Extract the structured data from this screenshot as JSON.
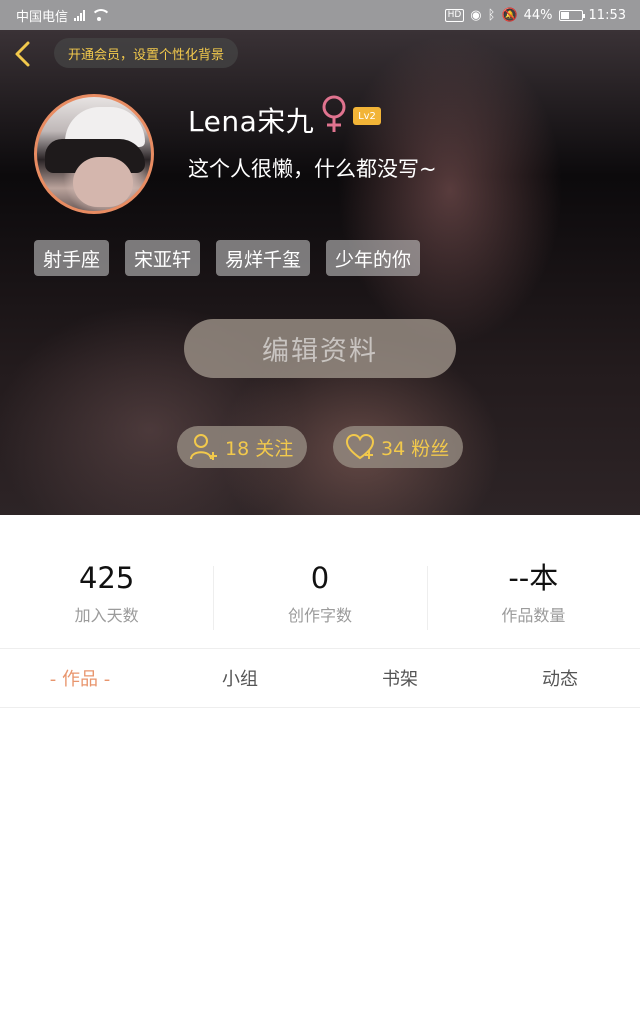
{
  "status_bar": {
    "carrier": "中国电信",
    "network": "4G",
    "battery": "44%",
    "battery_level": 0.44,
    "time": "11:53"
  },
  "header": {
    "vip_banner": "开通会员，设置个性化背景",
    "username": "Lena宋九",
    "level": "Lv2",
    "bio": "这个人很懒，什么都没写~",
    "tags": [
      "射手座",
      "宋亚轩",
      "易烊千玺",
      "少年的你"
    ],
    "edit_button": "编辑资料",
    "following": "18 关注",
    "fans": "34 粉丝"
  },
  "stats": [
    {
      "value": "425",
      "label": "加入天数"
    },
    {
      "value": "0",
      "label": "创作字数"
    },
    {
      "value": "--本",
      "label": "作品数量"
    }
  ],
  "tabs": [
    "- 作品 -",
    "小组",
    "书架",
    "动态"
  ],
  "colors": {
    "accent_orange": "#e8956d",
    "gold": "#f2c94c",
    "female_pink": "#e0738f"
  },
  "icons": [
    "back-icon",
    "female-icon",
    "add-user-icon",
    "heart-plus-icon",
    "wifi-icon",
    "battery-icon"
  ]
}
